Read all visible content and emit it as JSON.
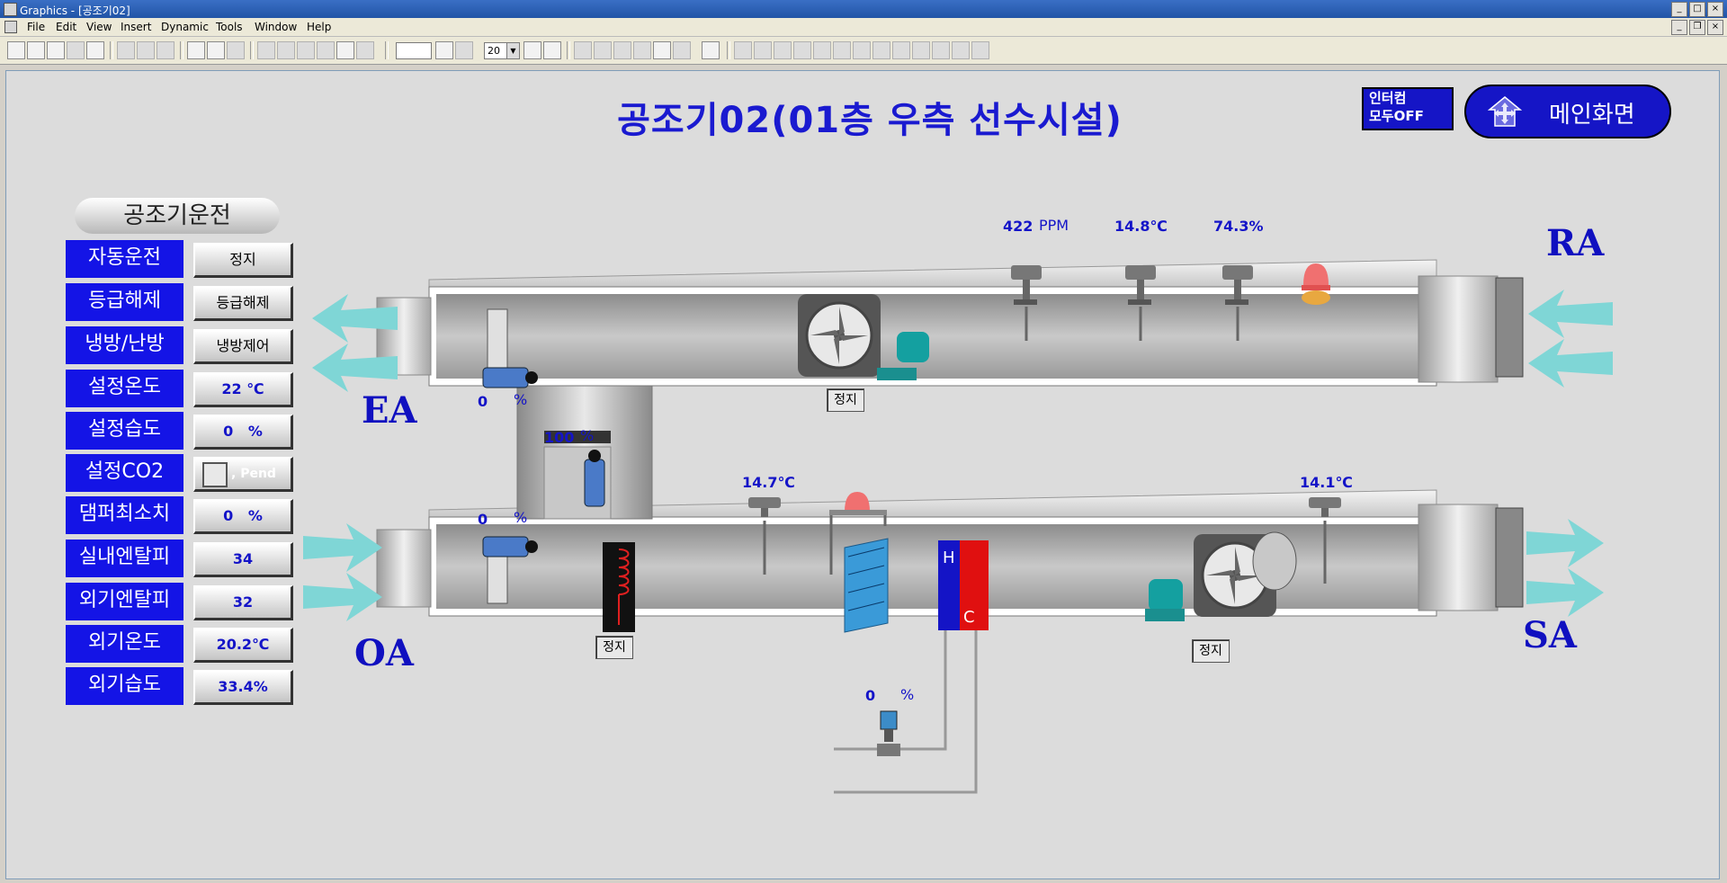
{
  "window": {
    "title": "Graphics - [공조기02]"
  },
  "menu": [
    "File",
    "Edit",
    "View",
    "Insert",
    "Dynamic",
    "Tools",
    "Window",
    "Help"
  ],
  "toolbar": {
    "zoom": "20"
  },
  "page": {
    "title": "공조기02(01층 우측 선수시설)"
  },
  "buttons": {
    "intercom_line1": "인터컴",
    "intercom_line2": "모두OFF",
    "main": "메인화면"
  },
  "control_panel": {
    "header": "공조기운전",
    "rows": [
      {
        "label": "자동운전",
        "value": "정지"
      },
      {
        "label": "등급해제",
        "value": "등급해제"
      },
      {
        "label": "냉방/난방",
        "value": "냉방제어"
      },
      {
        "label": "설정온도",
        "value": "22 ℃"
      },
      {
        "label": "설정습도",
        "value": "0   %"
      },
      {
        "label": "설정CO2",
        "value": ", Pend"
      },
      {
        "label": "댐퍼최소치",
        "value": "0   %"
      },
      {
        "label": "실내엔탈피",
        "value": "34"
      },
      {
        "label": "외기엔탈피",
        "value": "32"
      },
      {
        "label": "외기온도",
        "value": "20.2℃"
      },
      {
        "label": "외기습도",
        "value": "33.4%"
      }
    ]
  },
  "sensors": {
    "return_co2": {
      "value": "422",
      "unit": "PPM"
    },
    "return_temp": "14.8℃",
    "return_humidity": "74.3%",
    "exhaust_damper": {
      "value": "0",
      "unit": "%"
    },
    "mixing_damper": {
      "value": "100",
      "unit": "%"
    },
    "outdoor_damper": {
      "value": "0",
      "unit": "%"
    },
    "mixed_temp": "14.7℃",
    "supply_temp": "14.1℃",
    "valve": {
      "value": "0",
      "unit": "%"
    }
  },
  "status": {
    "return_fan": "정지",
    "preheater": "정지",
    "supply_fan": "정지"
  },
  "coil_labels": {
    "heat": "H",
    "cool": "C"
  },
  "air_labels": {
    "ea": "EA",
    "oa": "OA",
    "ra": "RA",
    "sa": "SA"
  },
  "colors": {
    "accent_blue": "#1414e6",
    "title_blue": "#1a1ad0",
    "arrow_cyan": "#7fd6d6"
  }
}
